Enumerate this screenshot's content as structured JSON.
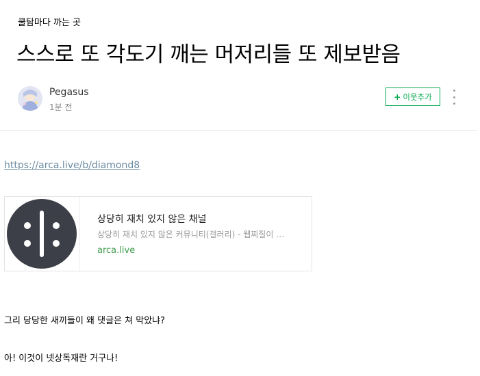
{
  "post": {
    "category": "쿨탐마다 까는 곳",
    "title": "스스로 또 각도기 깨는 머저리들 또 제보받음",
    "author": "Pegasus",
    "time": "1분 전",
    "add_neighbor_label": "이웃추가",
    "link_url": "https://arca.live/b/diamond8",
    "og_card": {
      "title": "상당히 재치 있지 않은 채널",
      "description": "상당히 재치 있지 않은 커뮤니티(갤러리) - 웹찌질이 …",
      "domain": "arca.live"
    },
    "paragraphs": [
      "그리 당당한 새끼들이 왜 댓글은 쳐 막았냐?",
      "아! 이것이 넷상독재란 거구나!"
    ]
  },
  "colors": {
    "accent_green": "#03a94d",
    "domain_green": "#3d9b4b",
    "link_blue": "#6a8aa0",
    "logo_dark": "#3c3f47"
  },
  "icons": {
    "more": "more-vertical-icon",
    "plus": "plus-icon",
    "logo": "arca-logo-icon"
  }
}
